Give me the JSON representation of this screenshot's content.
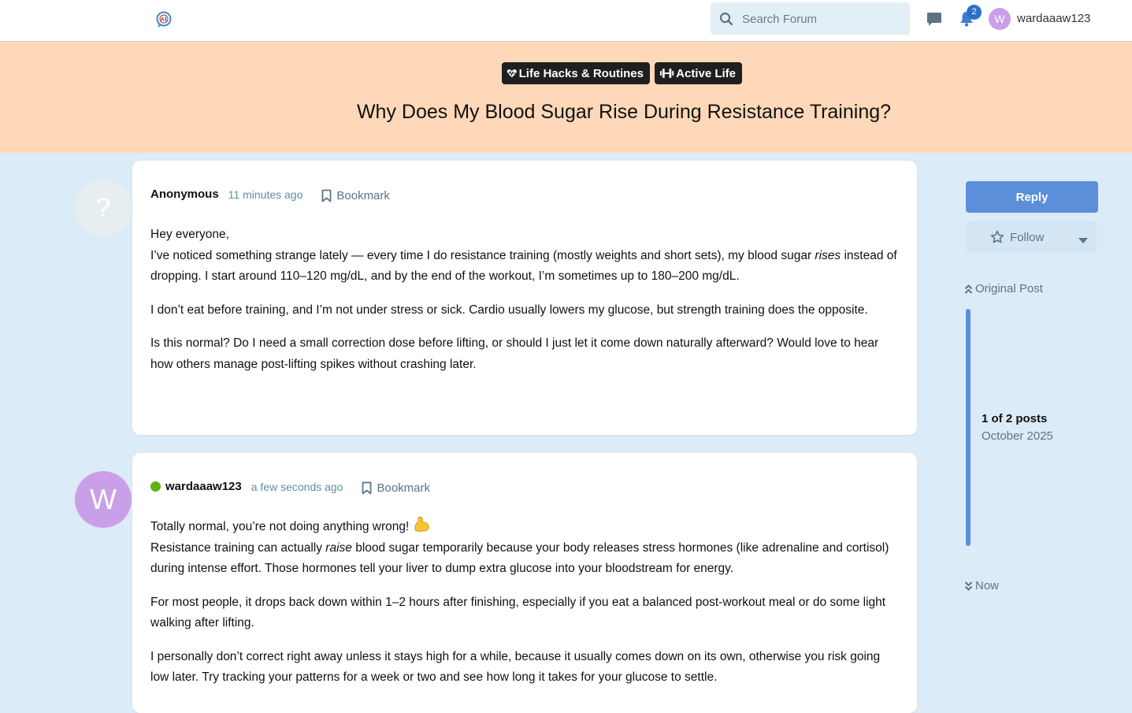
{
  "header": {
    "search_placeholder": "Search Forum",
    "notification_count": "2",
    "user_initial": "W",
    "username": "wardaaaw123"
  },
  "thread": {
    "tags": [
      {
        "label": "Life Hacks & Routines",
        "icon": "heart-pulse-icon"
      },
      {
        "label": "Active Life",
        "icon": "dumbbell-icon"
      }
    ],
    "title": "Why Does My Blood Sugar Rise During Resistance Training?"
  },
  "posts": [
    {
      "author": "Anonymous",
      "avatar": "?",
      "time": "11 minutes ago",
      "bookmark_label": "Bookmark",
      "greeting": "Hey everyone,",
      "p1_a": "I’ve noticed something strange lately — every time I do resistance training (mostly weights and short sets), my blood sugar ",
      "p1_em": "rises",
      "p1_b": " instead of dropping. I start around 110–120 mg/dL, and by the end of the workout, I’m sometimes up to 180–200 mg/dL.",
      "p2": "I don’t eat before training, and I’m not under stress or sick. Cardio usually lowers my glucose, but strength training does the opposite.",
      "p3": "Is this normal? Do I need a small correction dose before lifting, or should I just let it come down naturally afterward? Would love to hear how others manage post-lifting spikes without crashing later."
    },
    {
      "author": "wardaaaw123",
      "avatar": "W",
      "online": true,
      "time": "a few seconds ago",
      "bookmark_label": "Bookmark",
      "line1": "Totally normal, you’re not doing anything wrong!",
      "emoji": "flexed-biceps",
      "p1_a": "Resistance training can actually ",
      "p1_em": "raise",
      "p1_b": " blood sugar temporarily because your body releases stress hormones (like adrenaline and cortisol) during intense effort. Those hormones tell your liver to dump extra glucose into your bloodstream for energy.",
      "p2": "For most people, it drops back down within 1–2 hours after finishing, especially if you eat a balanced post-workout meal or do some light walking after lifting.",
      "p3": "I personally don’t correct right away unless it stays high for a while, because it usually comes down on its own, otherwise you risk going low later. Try tracking your patterns for a week or two and see how long it takes for your glucose to settle."
    }
  ],
  "sidebar": {
    "reply_label": "Reply",
    "follow_label": "Follow",
    "original_post_label": "Original Post",
    "post_count": "1 of 2 posts",
    "post_date": "October 2025",
    "now_label": "Now"
  },
  "colors": {
    "accent": "#5b8fd9",
    "hero_bg": "#fed8b8",
    "page_bg": "#dcebf8",
    "avatar_purple": "#c9a0e8",
    "online_green": "#5fb319"
  }
}
